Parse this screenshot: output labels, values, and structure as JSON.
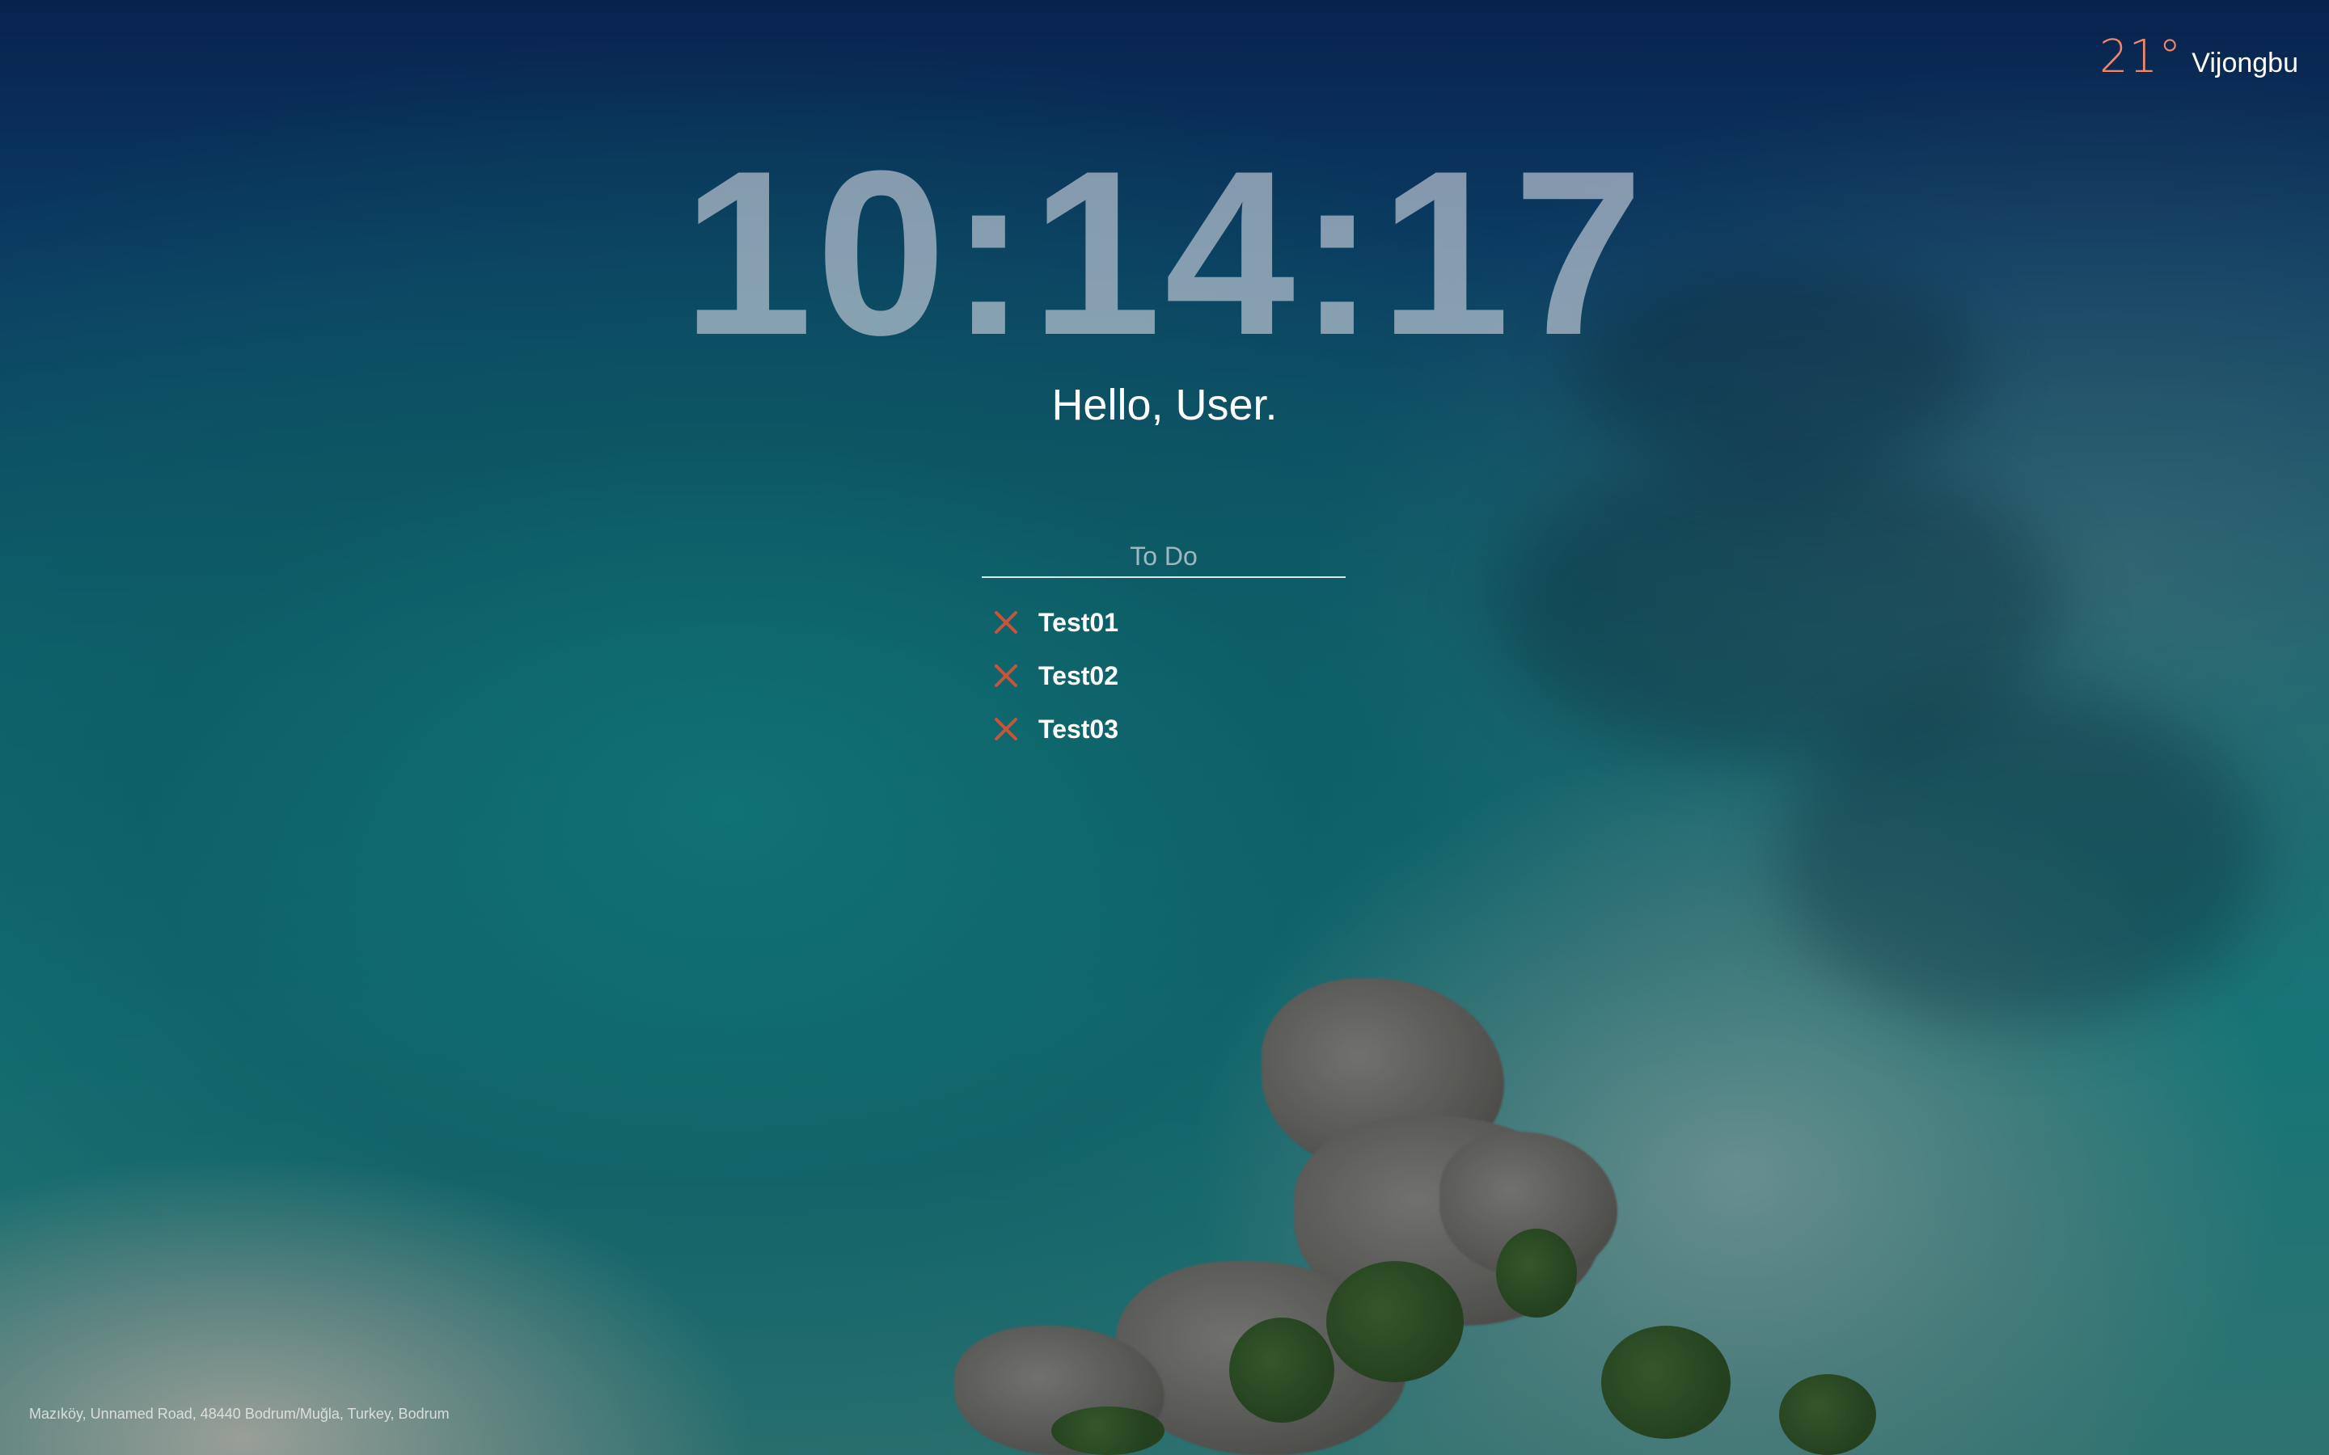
{
  "weather": {
    "temperature": "21°",
    "location": "Vijongbu"
  },
  "clock": {
    "time": "10:14:17"
  },
  "greeting": {
    "text": "Hello, User."
  },
  "todo": {
    "input_placeholder": "To Do",
    "input_value": "",
    "items": [
      {
        "label": "Test01",
        "delete_icon": "close-icon"
      },
      {
        "label": "Test02",
        "delete_icon": "close-icon"
      },
      {
        "label": "Test03",
        "delete_icon": "close-icon"
      }
    ]
  },
  "background": {
    "location_caption": "Mazıköy, Unnamed Road, 48440 Bodrum/Muğla, Turkey, Bodrum"
  },
  "colors": {
    "temperature": "#f2866a",
    "delete_icon": "#c8543a",
    "clock": "#d2d7e1"
  }
}
